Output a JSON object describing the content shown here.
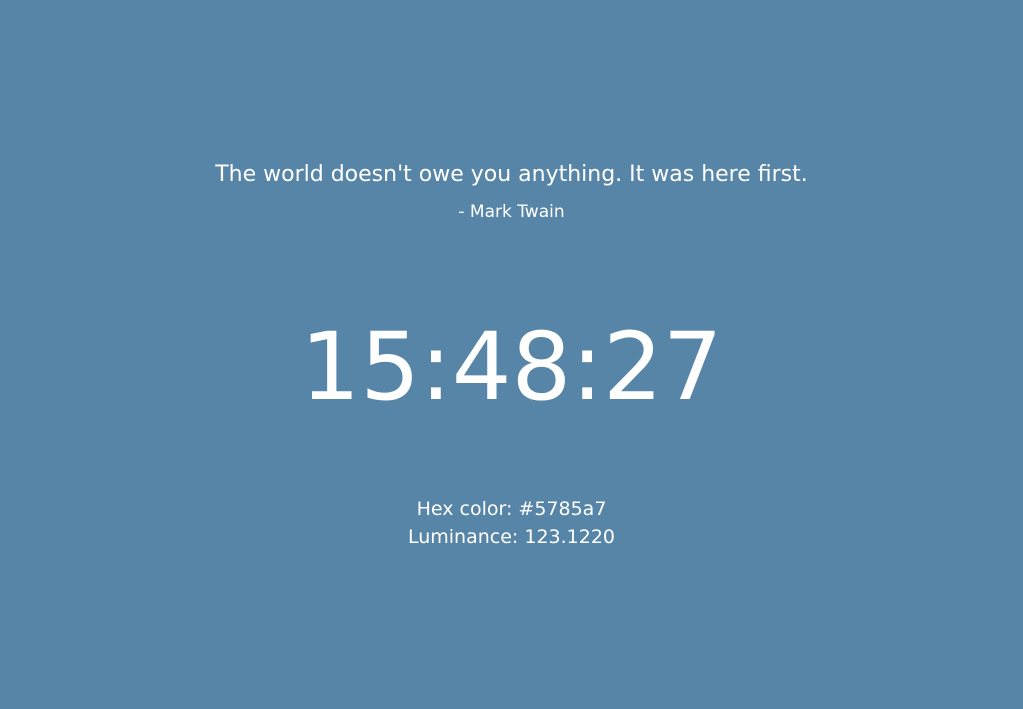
{
  "theme": {
    "background_color": "#5785a7",
    "text_color": "#ffffff"
  },
  "quote": {
    "text": "The world doesn't owe you anything. It was here first.",
    "author": "- Mark Twain"
  },
  "clock": {
    "time": "15:48:27"
  },
  "color_info": {
    "hex_label": "Hex color: #5785a7",
    "luminance_label": "Luminance: 123.1220"
  }
}
